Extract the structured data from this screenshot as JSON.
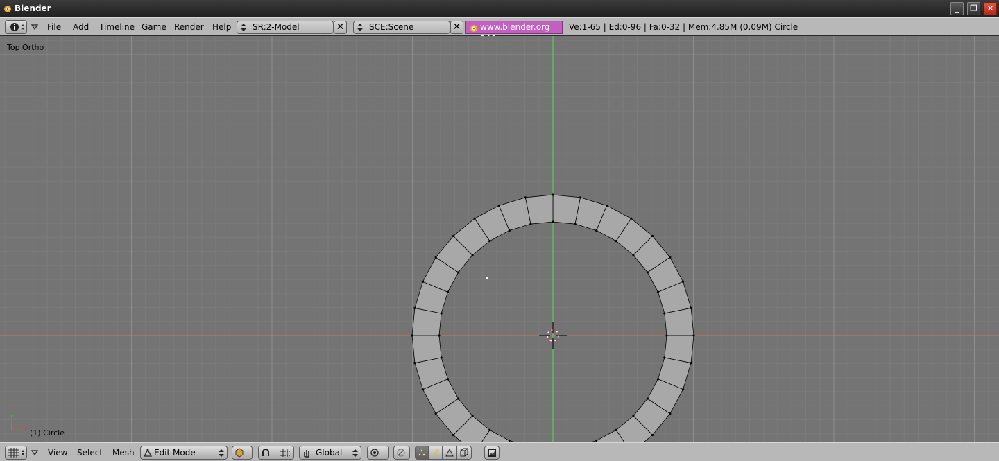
{
  "window": {
    "title": "Blender",
    "minimize_glyph": "_",
    "maximize_glyph": "❐",
    "close_glyph": "✕"
  },
  "topbar": {
    "menus": [
      "File",
      "Add",
      "Timeline",
      "Game",
      "Render",
      "Help"
    ],
    "screen_field": "SR:2-Model",
    "scene_field": "SCE:Scene",
    "url": "www.blender.org 246",
    "stats": "Ve:1-65 | Ed:0-96 | Fa:0-32 | Mem:4.85M (0.09M) Circle",
    "close_glyph": "✕"
  },
  "viewport": {
    "view_label": "Top Ortho",
    "object_label": "(1) Circle",
    "axis_y_label": "Y",
    "axis_x_label": "X"
  },
  "bottombar": {
    "menus": [
      "View",
      "Select",
      "Mesh"
    ],
    "mode": "Edit Mode",
    "orientation": "Global"
  },
  "colors": {
    "viewport_bg": "#747474",
    "grid_minor": "#7b7b7b",
    "grid_major": "#8e8e8e",
    "x_axis": "#e06a6a",
    "y_axis": "#4fe04f",
    "face": "#a8a8a8",
    "url_badge": "#c35fc0"
  },
  "icons": {
    "app": "blender-logo-icon",
    "info": "info-icon",
    "viewport_type": "3d-view-grid-icon"
  }
}
